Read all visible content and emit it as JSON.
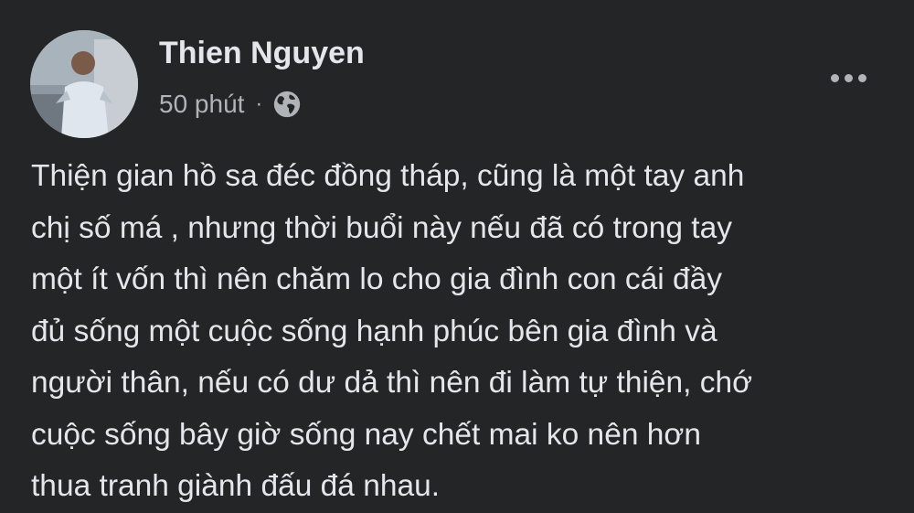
{
  "post": {
    "author": "Thien Nguyen",
    "timestamp": "50 phút",
    "separator": "·",
    "privacy_icon": "globe-icon",
    "options_icon": "more-options-icon",
    "text": "Thiện gian hồ sa đéc đồng tháp, cũng là một tay anh\nchị số má , nhưng thời buổi này nếu đã có trong tay\nmột ít vốn thì nên chăm lo cho gia đình con cái đầy\nđủ sống một cuộc sống hạnh phúc bên gia đình và\nngười thân, nếu có dư dả thì nên đi làm tự thiện, chớ\ncuộc sống bây giờ sống nay chết mai ko nên hơn\nthua tranh giành đấu đá nhau."
  },
  "colors": {
    "background": "#242526",
    "primary_text": "#e4e6eb",
    "secondary_text": "#b0b3b8"
  }
}
